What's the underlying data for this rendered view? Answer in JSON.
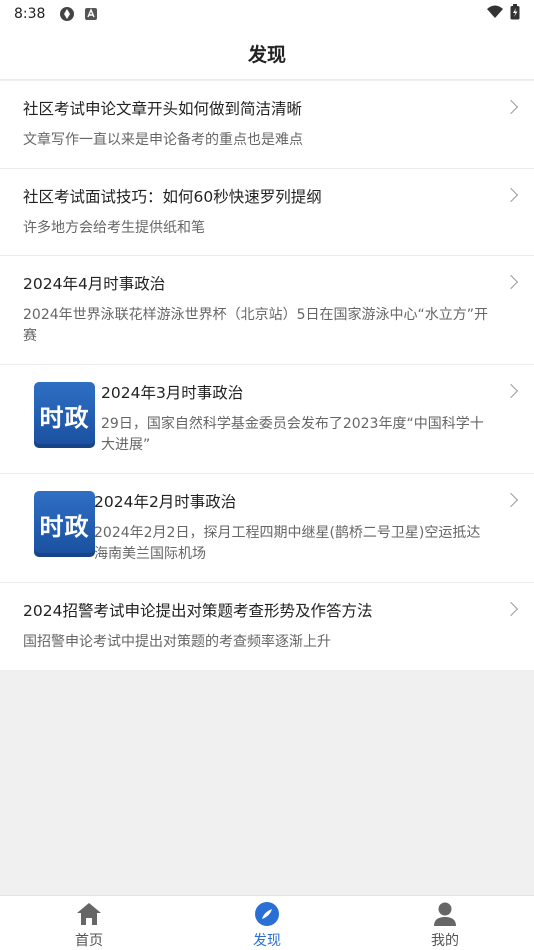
{
  "status_bar": {
    "time": "8:38"
  },
  "header": {
    "title": "发现"
  },
  "articles": [
    {
      "title": "社区考试申论文章开头如何做到简洁清晰",
      "desc": "文章写作一直以来是申论备考的重点也是难点"
    },
    {
      "title": "社区考试面试技巧：如何60秒快速罗列提纲",
      "desc": "许多地方会给考生提供纸和笔"
    },
    {
      "title": "2024年4月时事政治",
      "desc": "2024年世界泳联花样游泳世界杯（北京站）5日在国家游泳中心“水立方”开赛"
    },
    {
      "title": "2024年3月时事政治",
      "desc": "29日，国家自然科学基金委员会发布了2023年度“中国科学十大进展”",
      "thumb_text": "时政"
    },
    {
      "title": "2024年2月时事政治",
      "desc": "2024年2月2日，探月工程四期中继星(鹊桥二号卫星)空运抵达海南美兰国际机场",
      "thumb_text": "时政"
    },
    {
      "title": "2024招警考试申论提出对策题考查形势及作答方法",
      "desc": "国招警申论考试中提出对策题的考查频率逐渐上升"
    }
  ],
  "tabbar": {
    "home": "首页",
    "discover": "发现",
    "mine": "我的"
  },
  "colors": {
    "accent": "#2a6fd6",
    "thumb": "#1a4f9e"
  }
}
